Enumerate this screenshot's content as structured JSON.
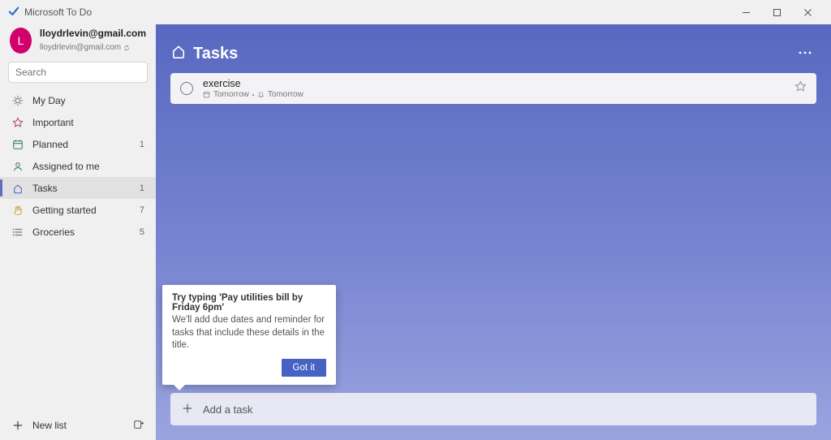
{
  "window": {
    "title": "Microsoft To Do"
  },
  "account": {
    "avatar_letter": "L",
    "name": "lloydrlevin@gmail.com",
    "sub": "lloydrlevin@gmail.com"
  },
  "search": {
    "placeholder": "Search"
  },
  "nav": {
    "items": [
      {
        "icon": "sun",
        "label": "My Day",
        "count": ""
      },
      {
        "icon": "star",
        "label": "Important",
        "count": ""
      },
      {
        "icon": "cal",
        "label": "Planned",
        "count": "1"
      },
      {
        "icon": "user",
        "label": "Assigned to me",
        "count": ""
      },
      {
        "icon": "home",
        "label": "Tasks",
        "count": "1",
        "active": true
      },
      {
        "icon": "hand",
        "label": "Getting started",
        "count": "7"
      },
      {
        "icon": "list",
        "label": "Groceries",
        "count": "5"
      }
    ],
    "newlist_label": "New list"
  },
  "page": {
    "title": "Tasks",
    "tasks": [
      {
        "title": "exercise",
        "due_label": "Tomorrow",
        "reminder_label": "Tomorrow",
        "completed": false,
        "starred": false
      }
    ],
    "addtask_placeholder": "Add a task"
  },
  "tip": {
    "title": "Try typing 'Pay utilities bill by Friday 6pm'",
    "body": "We'll add due dates and reminder for tasks that include these details in the title.",
    "button": "Got it"
  }
}
